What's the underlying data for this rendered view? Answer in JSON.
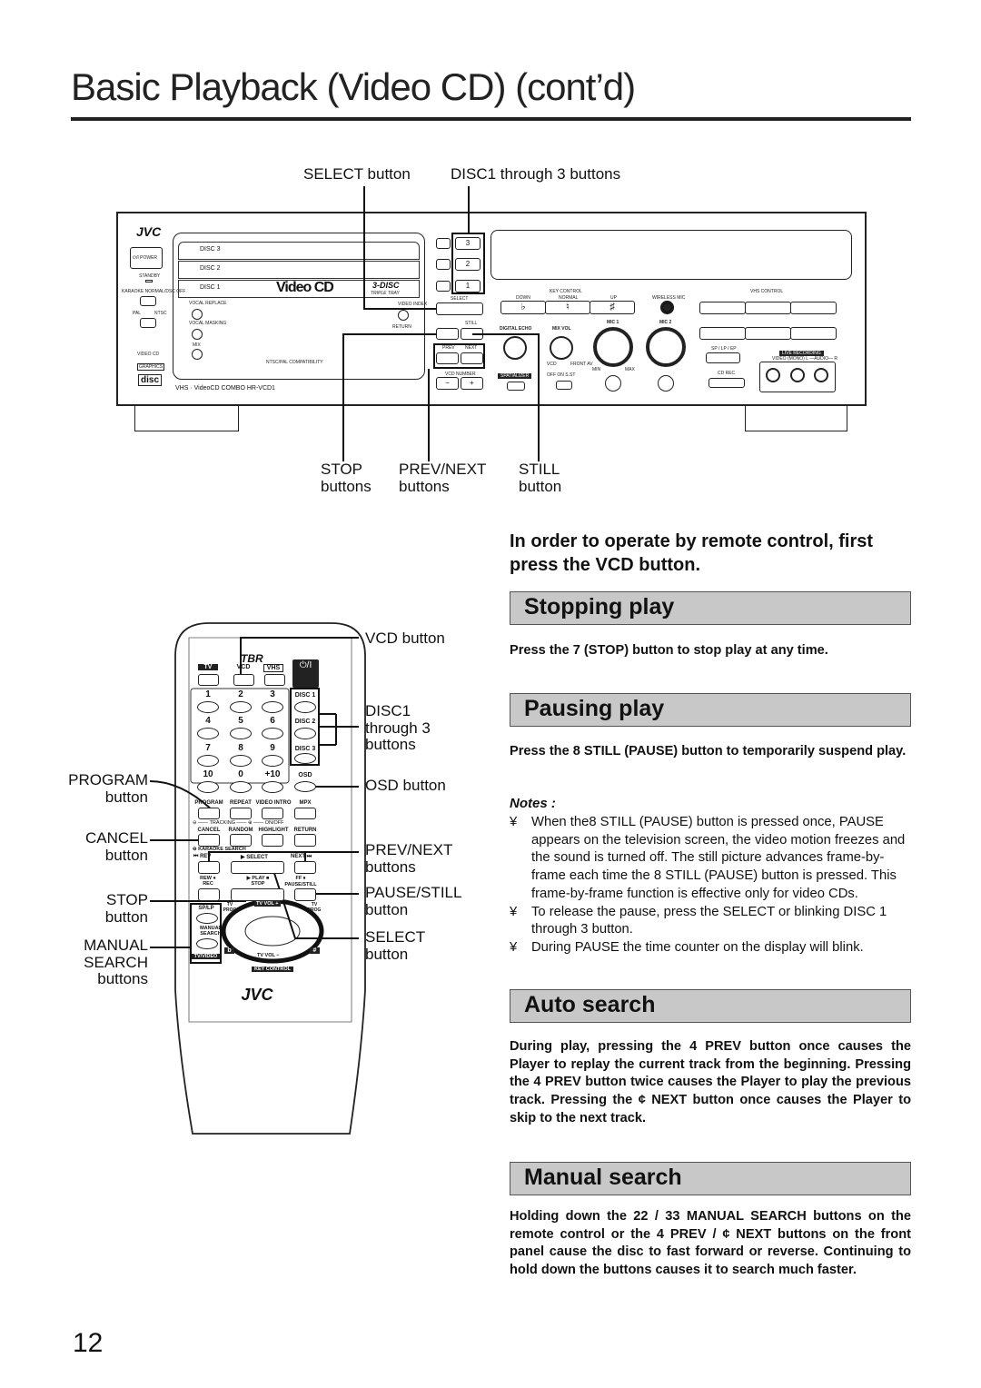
{
  "page": {
    "title": "Basic Playback (Video CD) (cont’d)",
    "page_number": "12"
  },
  "front_panel": {
    "callouts": {
      "select": "SELECT button",
      "disc": "DISC1 through 3 buttons",
      "stop": [
        "STOP",
        "buttons"
      ],
      "prevnext": [
        "PREV/NEXT",
        "buttons"
      ],
      "still": [
        "STILL",
        "button"
      ]
    },
    "labels": {
      "brand": "JVC",
      "power": "⏻/I POWER",
      "standby": "STANDBY",
      "karaoke": "KARAOKE NORMAL/DSC OFF",
      "pal": "PAL",
      "ntsc": "NTSC",
      "videocd_logo": "VIDEO CD",
      "graphics": "GRAPHICS",
      "disc_logo": "disc",
      "disc3": "DISC 3",
      "disc2": "DISC 2",
      "disc1": "DISC 1",
      "videocd": "Video CD",
      "triple": "3-DISC",
      "triple_sub": "TRIPLE TRAY",
      "vocal_replace": "VOCAL REPLACE",
      "vocal_masking": "VOCAL MASKING",
      "mix": "MIX",
      "video_index": "VIDEO INDEX",
      "return": "RETURN",
      "ntsc_pal": "NTSC/PAL COMPATIBILITY",
      "model": "VHS · VideoCD COMBO HR-VCD1",
      "num3": "3",
      "num2": "2",
      "num1": "1",
      "select": "SELECT",
      "still": "STILL",
      "prev": "PREV",
      "next": "NEXT",
      "vcd_number": "VCD NUMBER",
      "minus": "−",
      "plus": "+",
      "key_control": "KEY CONTROL",
      "down": "DOWN",
      "normal": "NORMAL",
      "up": "UP",
      "flat": "♭",
      "natural": "♮",
      "sharp": "♯",
      "wireless_mic": "WIRELESS MIC",
      "vhs_control": "VHS CONTROL",
      "digital_echo": "DIGITAL ECHO",
      "mix_vol": "MIX VOL",
      "mic1": "MIC 1",
      "mic2": "MIC 2",
      "min": "MIN",
      "max": "MAX",
      "vcd": "VCD",
      "front_av": "FRONT AV",
      "spatializer": "SPATIALIZER",
      "off_on_sst": "OFF ON S.ST",
      "sp_lp_ep": "SP / LP / EP",
      "cd_rec": "CD REC",
      "live_recording": "LIVE RECORDING",
      "video_audio": "VIDEO (MONO) L —AUDIO— R"
    }
  },
  "remote": {
    "callouts_left": {
      "program": [
        "PROGRAM",
        "button"
      ],
      "cancel": [
        "CANCEL",
        "button"
      ],
      "stop": [
        "STOP",
        "button"
      ],
      "manual": [
        "MANUAL",
        "SEARCH",
        "buttons"
      ]
    },
    "callouts_right": {
      "vcd": [
        "VCD button"
      ],
      "disc": [
        "DISC1",
        "through 3",
        "buttons"
      ],
      "osd": [
        "OSD button"
      ],
      "prevnext": [
        "PREV/NEXT",
        "buttons"
      ],
      "pause": [
        "PAUSE/STILL",
        "button"
      ],
      "select": [
        "SELECT",
        "button"
      ]
    },
    "labels": {
      "logo": "TBR",
      "tv": "TV",
      "vcd": "VCD",
      "vhs": "VHS",
      "power": "⏻/I",
      "numbers": [
        "1",
        "2",
        "3",
        "4",
        "5",
        "6",
        "7",
        "8",
        "9",
        "10",
        "0",
        "+10"
      ],
      "disc1": "DISC 1",
      "disc2": "DISC 2",
      "disc3": "DISC 3",
      "osd": "OSD",
      "program": "PROGRAM",
      "repeat": "REPEAT",
      "video_intro": "VIDEO INTRO",
      "mpx": "MPX",
      "tracking": "⊖ —— TRACKING —— ⊕ —— ON/OFF",
      "cancel": "CANCEL",
      "random": "RANDOM",
      "highlight": "HIGHLIGHT",
      "return": "RETURN",
      "karaoke_search": "⊖ KARAOKE SEARCH",
      "rev": "⏮ REV",
      "select": "▶ SELECT",
      "next": "NEXT ⏭",
      "rew_rec": "REW ● REC",
      "play_stop": "▶ PLAY ■ STOP",
      "ff_pause": "FF ⏸ PAUSE/STILL",
      "splp": "SP/LP",
      "manual_search": "MANUAL SEARCH",
      "tvvideo": "TV/VIDEO",
      "tv_prog": "TV PROG",
      "tv_vol_plus": "TV VOL +",
      "tv_vol_minus": "TV VOL −",
      "key_control": "KEY CONTROL",
      "flat": "b",
      "sharp": "#",
      "brand": "JVC"
    }
  },
  "right": {
    "intro": "In order to operate by remote control, first press the VCD button.",
    "stopping": {
      "heading": "Stopping play",
      "text": "Press the 7  (STOP) button to stop play at any time."
    },
    "pausing": {
      "heading": "Pausing play",
      "text": "Press the 8  STILL (PAUSE) button to temporarily suspend play.",
      "notes_label": "Notes :",
      "bullet": "¥",
      "notes": [
        "When the8  STILL (PAUSE) button is pressed once,  PAUSE  appears on the television screen, the video motion freezes and the sound is turned off. The still picture advances frame-by-frame each time the 8  STILL (PAUSE) button is pressed. This frame-by-frame function is effective only for video CDs.",
        "To release the pause, press the SELECT or blinking DISC 1 through 3 button.",
        "During  PAUSE  the time counter on the display will blink."
      ]
    },
    "auto": {
      "heading": "Auto search",
      "text": "During play, pressing the 4     PREV button once causes the Player to replay the current track from the beginning. Pressing the 4     PREV button twice causes the Player to play the previous track.  Pressing the ¢     NEXT button once causes the Player to skip to the next track."
    },
    "manual": {
      "heading": "Manual search",
      "text": "Holding down the 22   / 33   MANUAL SEARCH buttons on the remote control or the 4     PREV / ¢     NEXT buttons on the front panel cause the disc to fast forward or reverse. Continuing to hold down the buttons causes it to search much faster."
    }
  }
}
